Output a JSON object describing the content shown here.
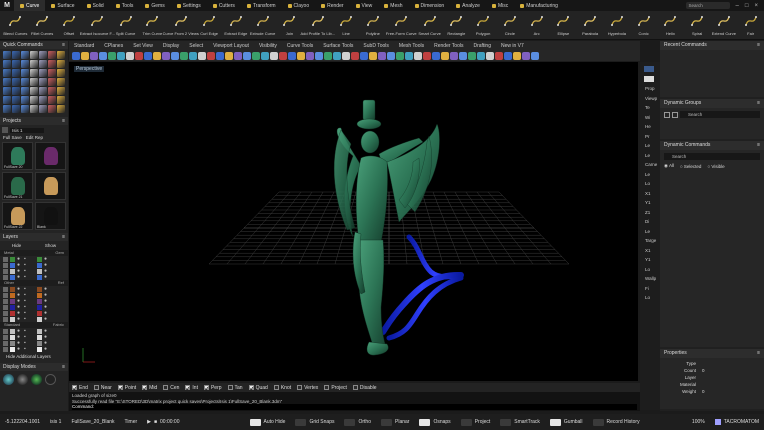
{
  "app": {
    "logo": "M"
  },
  "tabs": [
    "Curve",
    "Surface",
    "Solid",
    "Tools",
    "Gems",
    "Settings",
    "Cutters",
    "Transform",
    "Clayoo",
    "Render",
    "View",
    "Mesh",
    "Dimension",
    "Analyze",
    "Misc",
    "Manufacturing"
  ],
  "active_tab": "Curve",
  "search_placeholder": "Search",
  "ribbon": [
    "Blend Curves",
    "Fillet Curves",
    "Offset",
    "Extract Isocurve F...",
    "Split Curve",
    "Trim Curve",
    "Curve From 2 Views",
    "Curl Edge",
    "Extract Edge",
    "Extrude Curve",
    "Join",
    "Add Profile To Lib...",
    "Line",
    "Polyline",
    "Free-Form Curve",
    "Smart Curve",
    "Rectangle",
    "Polygon",
    "Circle",
    "Arc",
    "Ellipse",
    "Parabola",
    "Hyperbola",
    "Conic",
    "Helix",
    "Spiral",
    "Extend Curve",
    "Fair"
  ],
  "left": {
    "quick_commands_title": "Quick Commands",
    "projects_title": "Projects",
    "project_select": "Isis 1",
    "full_save": "Full Save",
    "edit_rep": "Edit Rep",
    "thumbs": [
      "FullSave 20",
      "",
      "FullSave 21",
      "",
      "FullSave 22",
      "Blank"
    ],
    "layers_title": "Layers",
    "hide": "Hide",
    "show": "Show",
    "col_metal": "Metal",
    "col_gem": "Gem",
    "col_other": "Other",
    "col_ref": "Ref",
    "col_standard": "Standard",
    "col_fabric": "Fabric",
    "hide_additional": "Hide Additional Layers",
    "display_modes_title": "Display Modes"
  },
  "viewport_tabs": [
    "Standard",
    "CPlanes",
    "Set View",
    "Display",
    "Select",
    "Viewport Layout",
    "Visibility",
    "Curve Tools",
    "Surface Tools",
    "SubD Tools",
    "Mesh Tools",
    "Render Tools",
    "Drafting",
    "New in V7"
  ],
  "viewport_label": "Perspective",
  "right": {
    "recent_title": "Recent Commands",
    "groups_title": "Dynamic Groups",
    "groups_search": "Search",
    "dyn_title": "Dynamic Commands",
    "dyn_search": "Search",
    "filter_all": "All",
    "filter_selected": "Selected",
    "filter_visible": "Visible",
    "props_title": "Properties",
    "props": [
      {
        "k": "Type",
        "v": ""
      },
      {
        "k": "Count",
        "v": "0"
      },
      {
        "k": "Layer",
        "v": ""
      },
      {
        "k": "Material",
        "v": ""
      },
      {
        "k": "Weight",
        "v": "0"
      }
    ],
    "side_labels": [
      "Prop",
      "Viewp",
      "Te",
      "Wi",
      "He",
      "Pr",
      "Le",
      "Le",
      "Carne",
      "Le",
      "Lo",
      "X1",
      "Y1",
      "Z1",
      "Di",
      "Le",
      "Targe",
      "X1",
      "Y1",
      "Lo",
      "Wallp",
      "Fi",
      "Lo"
    ]
  },
  "osnap": [
    "End",
    "Near",
    "Point",
    "Mid",
    "Cen",
    "Int",
    "Perp",
    "Tan",
    "Quad",
    "Knot",
    "Vertex",
    "Project",
    "Disable"
  ],
  "osnap_checked": [
    true,
    false,
    true,
    true,
    false,
    true,
    true,
    false,
    true,
    false,
    false,
    false,
    false
  ],
  "command": {
    "lines": [
      "Loaded graph of size0",
      "Successfully read file \"E:\\STORED\\3D\\matrix project quick saves\\Projects\\Isis 1\\FullSave_20_Blank.3dm\""
    ],
    "prompt": "Command:"
  },
  "status": {
    "coord": "-5.122204.1001",
    "layer": "isis 1",
    "file": "FullSave_20_Blank",
    "timer_label": "Timer",
    "time": "00:00:00",
    "toggles": [
      "Auto Hide",
      "Grid Snaps",
      "Ortho",
      "Planar",
      "Osnaps",
      "Project",
      "SmartTrack",
      "Gumball",
      "Record History"
    ],
    "toggles_on": [
      true,
      false,
      false,
      false,
      true,
      false,
      false,
      true,
      false
    ],
    "zoom": "100%",
    "brand": "TACROMATOM"
  },
  "colors": {
    "model": "#2e7a5a",
    "curve": "#1a2fd8",
    "bg": "#000000"
  }
}
